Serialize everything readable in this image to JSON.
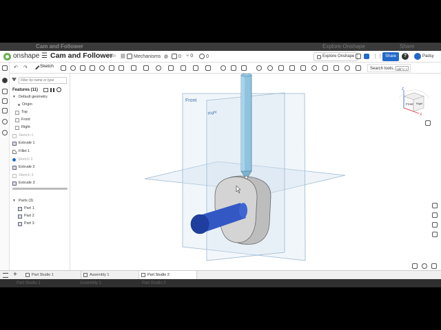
{
  "ghost": {
    "title": "Cam and Follower",
    "explore": "Explore Onshape",
    "share": "Share",
    "tab1": "Part Studio 1",
    "tab2": "Assembly 1",
    "tab3": "Part Studio 2"
  },
  "header": {
    "brand": "onshape",
    "doc_title": "Cam and Follower",
    "branch": "Main",
    "folder": "Mechanisms",
    "count_a": "0",
    "count_b": "0",
    "count_c": "0",
    "explore": "Explore Onshape",
    "share": "Share",
    "help": "?",
    "user": "Padsy"
  },
  "toolbar": {
    "sketch": "Sketch",
    "search_tools": "Search tools...",
    "search_shortcut": "alt/⌥ c"
  },
  "features": {
    "filter_placeholder": "Filter by name or type",
    "title": "Features (11)",
    "default_geometry": "Default geometry",
    "items": [
      {
        "label": "Origin"
      },
      {
        "label": "Top"
      },
      {
        "label": "Front"
      },
      {
        "label": "Right"
      },
      {
        "label": "Sketch 1"
      },
      {
        "label": "Extrude 1"
      },
      {
        "label": "Fillet 1"
      },
      {
        "label": "Sketch 2"
      },
      {
        "label": "Extrude 2"
      },
      {
        "label": "Sketch 3"
      },
      {
        "label": "Extrude 3"
      }
    ],
    "parts_title": "Parts (3)",
    "parts": [
      {
        "label": "Part 1"
      },
      {
        "label": "Part 2"
      },
      {
        "label": "Part 3"
      }
    ]
  },
  "viewport": {
    "plane_front": "Front",
    "plane_right": "Right",
    "cube_front": "Front",
    "cube_right": "Right",
    "axis_z": "Z",
    "axis_x": "X"
  },
  "tabs": [
    {
      "label": "Part Studio 1"
    },
    {
      "label": "Assembly 1"
    },
    {
      "label": "Part Studio 2"
    }
  ],
  "colors": {
    "share": "#2369c9",
    "plane": "#cfe0ee",
    "follower": "#8fc3de",
    "cam": "#c8c8c8",
    "shaft": "#2a52b8"
  }
}
